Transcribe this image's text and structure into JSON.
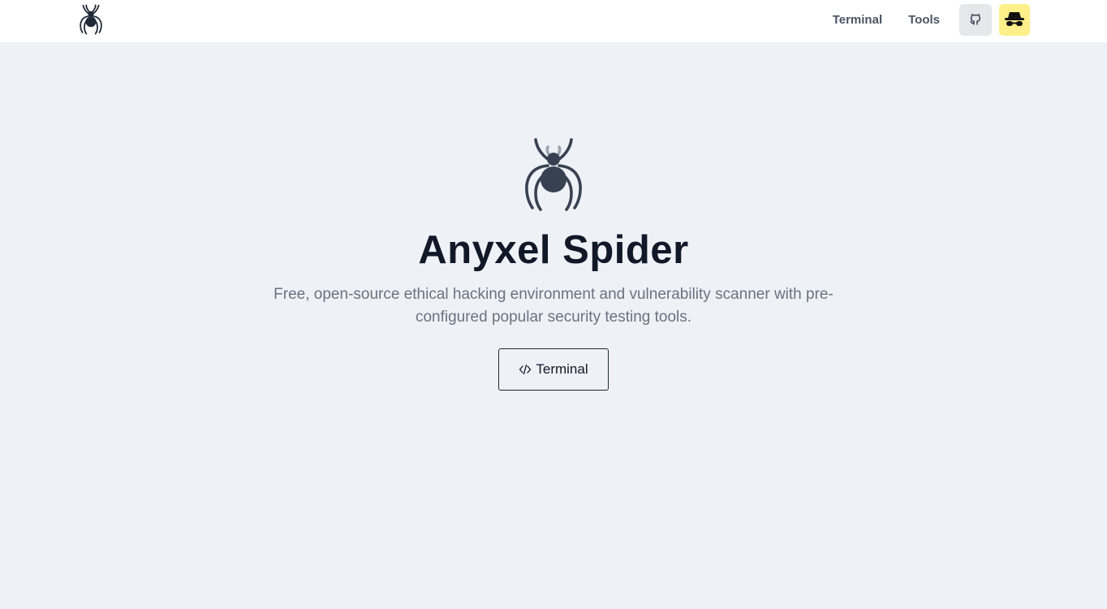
{
  "nav": {
    "logo_icon": "spider-icon",
    "links": [
      "Terminal",
      "Tools"
    ],
    "github_icon": "github-icon",
    "theme_icon": "incognito-icon",
    "theme_button_color": "#fdf08a"
  },
  "hero": {
    "logo_icon": "spider-icon",
    "title": "Anyxel Spider",
    "subtitle": "Free, open-source ethical hacking environment and vulnerability scanner with pre-configured popular security testing tools.",
    "cta_label": "Terminal",
    "cta_icon": "code-icon"
  },
  "colors": {
    "background": "#eef1f6",
    "navbar": "#ffffff",
    "spider": "#374151"
  }
}
